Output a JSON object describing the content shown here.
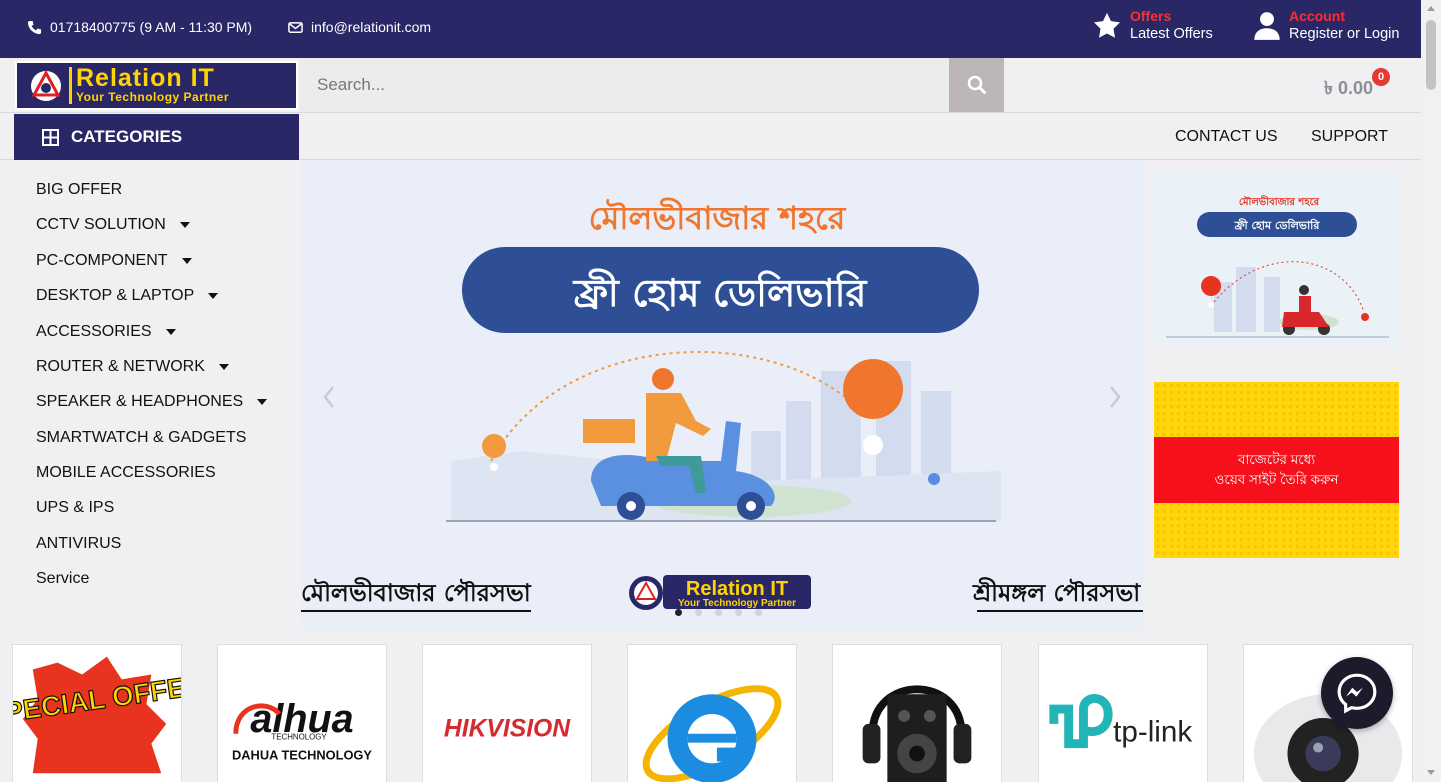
{
  "topbar": {
    "phone": "01718400775 (9 AM - 11:30 PM)",
    "email": "info@relationit.com",
    "offers_title": "Offers",
    "offers_sub": "Latest Offers",
    "account_title": "Account",
    "account_sub": "Register or Login"
  },
  "header": {
    "logo_line1": "Relation IT",
    "logo_line2": "Your Technology Partner",
    "search_placeholder": "Search...",
    "cart_total": "৳ 0.00",
    "cart_count": "0"
  },
  "nav": {
    "categories_label": "CATEGORIES",
    "links": [
      "CONTACT US",
      "SUPPORT"
    ]
  },
  "sidebar": {
    "items": [
      {
        "label": "BIG OFFER"
      },
      {
        "label": "CCTV SOLUTION"
      },
      {
        "label": "PC-COMPONENT"
      },
      {
        "label": "DESKTOP & LAPTOP"
      },
      {
        "label": "ACCESSORIES"
      },
      {
        "label": "ROUTER & NETWORK"
      },
      {
        "label": "SPEAKER & HEADPHONES"
      },
      {
        "label": "SMARTWATCH & GADGETS"
      },
      {
        "label": "MOBILE ACCESSORIES"
      },
      {
        "label": "UPS & IPS"
      },
      {
        "label": "ANTIVIRUS"
      },
      {
        "label": "Service"
      }
    ]
  },
  "slider": {
    "headline": "মৌলভীবাজার শহরে",
    "pill_text": "ফ্রী হোম ডেলিভারি",
    "footer_left": "মৌলভীবাজার পৌরসভা",
    "footer_right": "শ্রীমঙ্গল পৌরসভা",
    "logo_line1": "Relation IT",
    "logo_line2": "Your Technology Partner",
    "active_slide": 1,
    "slide_count": 5
  },
  "side_ads": {
    "ad1_headline": "মৌলভীবাজার শহরে",
    "ad1_pill": "ফ্রী হোম ডেলিভারি",
    "ad2_line1": "বাজেটের মধ্যে",
    "ad2_line2": "ওয়েব সাইট তৈরি করুন"
  },
  "brands": {
    "special_offer": "SPECIAL OFFER",
    "dahua": "alhua",
    "dahua_sub": "TECHNOLOGY",
    "dahua_caption": "DAHUA TECHNOLOGY",
    "hikvision": "HIKVISION",
    "tplink": "tp-link"
  },
  "colors": {
    "navy": "#2a2766",
    "accent_red": "#ff2d2d",
    "logo_yellow": "#ffd400"
  }
}
